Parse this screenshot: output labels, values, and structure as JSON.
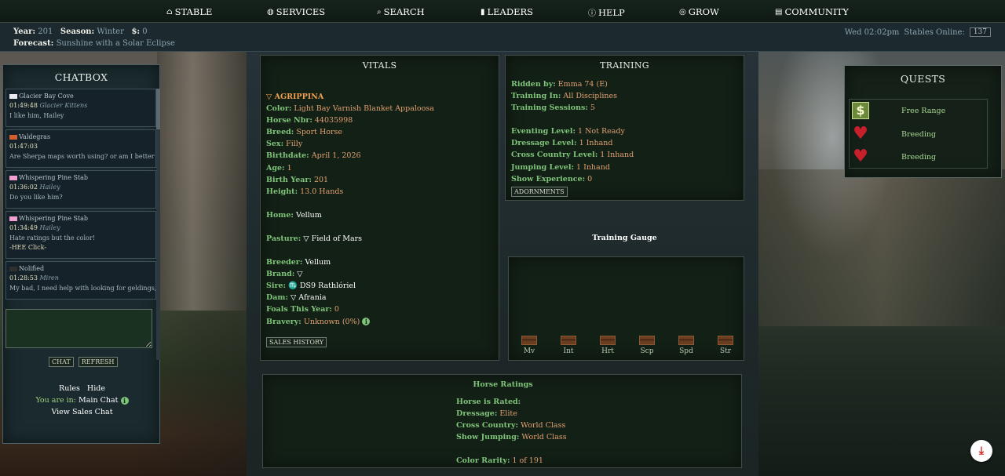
{
  "nav": [
    {
      "label": "STABLE",
      "icon": "home-icon"
    },
    {
      "label": "SERVICES",
      "icon": "globe-icon"
    },
    {
      "label": "SEARCH",
      "icon": "search-icon"
    },
    {
      "label": "LEADERS",
      "icon": "bar-chart-icon"
    },
    {
      "label": "HELP",
      "icon": "info-icon"
    },
    {
      "label": "GROW",
      "icon": "target-icon"
    },
    {
      "label": "COMMUNITY",
      "icon": "comment-icon"
    }
  ],
  "info": {
    "year_label": "Year:",
    "year": "201",
    "season_label": "Season:",
    "season": "Winter",
    "money_label": "$:",
    "money": "0",
    "forecast_label": "Forecast:",
    "forecast": "Sunshine with a Solar Eclipse",
    "datetime": "Wed 02:02pm",
    "online_label": "Stables Online:",
    "online_count": "137"
  },
  "chatbox": {
    "title": "CHATBOX",
    "messages": [
      {
        "stable": "Glacier Bay Cove",
        "time": "01:49:48",
        "user": "Glacier Kittens",
        "text": "I like him, Hailey",
        "flag_color": "#e8e8f0"
      },
      {
        "stable": "Valdegras",
        "time": "01:47:03",
        "user": "",
        "text": "Are Sherpa maps worth using? or am I better off selling?",
        "flag_color": "#d06030"
      },
      {
        "stable": "Whispering Pine Stab",
        "time": "01:36:02",
        "user": "Hailey",
        "text": "Do you like him?",
        "flag_color": "#f0a0d0"
      },
      {
        "stable": "Whispering Pine Stab",
        "time": "01:34:49",
        "user": "Hailey",
        "text": "Hate ratings but the color!",
        "text2": "-HEE Click-",
        "flag_color": "#f0a0d0"
      },
      {
        "stable": "Nolified",
        "time": "01:28:53",
        "user": "Miren",
        "text": "My bad, I need help with looking for geldings, I'm not",
        "flag_color": "#303030"
      }
    ],
    "chat_btn": "CHAT",
    "refresh_btn": "REFRESH",
    "rules": "Rules",
    "hide": "Hide",
    "room_label": "You are in:",
    "room": "Main Chat",
    "sales_chat": "View Sales Chat"
  },
  "vitals": {
    "title": "VITALS",
    "name": "▽ AGRIPPINA",
    "color_label": "Color:",
    "color": "Light Bay Varnish Blanket Appaloosa",
    "nbr_label": "Horse Nbr:",
    "nbr": "44035998",
    "breed_label": "Breed:",
    "breed": "Sport Horse",
    "sex_label": "Sex:",
    "sex": "Filly",
    "birthdate_label": "Birthdate:",
    "birthdate": "April 1, 2026",
    "age_label": "Age:",
    "age": "1",
    "birthyear_label": "Birth Year:",
    "birthyear": "201",
    "height_label": "Height:",
    "height": "13.0 Hands",
    "home_label": "Home:",
    "home": "Vellum",
    "pasture_label": "Pasture:",
    "pasture": "▽ Field of Mars",
    "breeder_label": "Breeder:",
    "breeder": "Vellum",
    "brand_label": "Brand:",
    "brand": "▽",
    "sire_label": "Sire:",
    "sire": "♏ DS9 Rathlóriel",
    "dam_label": "Dam:",
    "dam": "▽ Afrania",
    "foals_label": "Foals This Year:",
    "foals": "0",
    "bravery_label": "Bravery:",
    "bravery": "Unknown (0%)",
    "sales_history_btn": "SALES HISTORY"
  },
  "training": {
    "title": "TRAINING",
    "ridden_label": "Ridden by:",
    "ridden": "Emma 74 (E)",
    "training_in_label": "Training In:",
    "training_in": "All Disciplines",
    "sessions_label": "Training Sessions:",
    "sessions": "5",
    "eventing_label": "Eventing Level:",
    "eventing": "1 Not Ready",
    "dressage_label": "Dressage Level:",
    "dressage": "1 Inhand",
    "cross_label": "Cross Country Level:",
    "cross": "1 Inhand",
    "jumping_label": "Jumping Level:",
    "jumping": "1 Inhand",
    "show_exp_label": "Show Experience:",
    "show_exp": "0",
    "adornments_btn": "ADORNMENTS"
  },
  "gauge": {
    "title": "Training Gauge",
    "stats": [
      "Mv",
      "Int",
      "Hrt",
      "Scp",
      "Spd",
      "Str"
    ]
  },
  "ratings": {
    "title": "Horse Ratings",
    "rated_label": "Horse is Rated:",
    "dressage_label": "Dressage:",
    "dressage": "Elite",
    "cross_label": "Cross Country:",
    "cross": "World Class",
    "jumping_label": "Show Jumping:",
    "jumping": "World Class",
    "rarity_label": "Color Rarity:",
    "rarity": "1 of 191"
  },
  "quests": {
    "title": "QUESTS",
    "items": [
      {
        "label": "Free Range",
        "icon": "money-icon"
      },
      {
        "label": "Breeding",
        "icon": "heart-icon"
      },
      {
        "label": "Breeding",
        "icon": "heart-icon"
      }
    ]
  },
  "colors": {
    "accent_green": "#7fc47a",
    "value_orange": "#e0a070",
    "pdf_red": "#d8231d"
  }
}
